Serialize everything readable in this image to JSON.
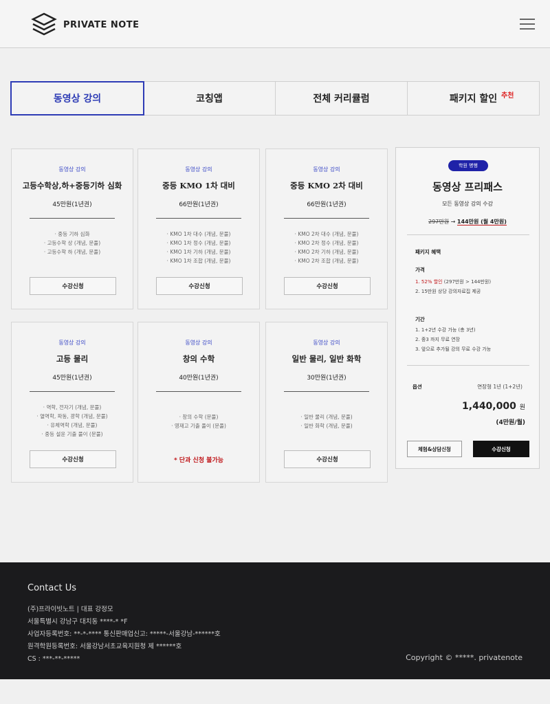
{
  "header": {
    "logo_text": "PRIVATE NOTE",
    "menu_icon": "hamburger-menu-icon"
  },
  "tabs": [
    {
      "label": "동영상 강의"
    },
    {
      "label": "코칭앱"
    },
    {
      "label": "전체 커리큘럼"
    },
    {
      "label": "패키지 할인",
      "badge": "추천"
    }
  ],
  "courses": [
    {
      "category": "동영상 강의",
      "title": "고등수학상,하+중등기하 심화",
      "price": "45만원(1년권)",
      "topics": [
        "· 중등 기하 심화",
        "· 고등수학 상 (개념, 문풀)",
        "· 고등수학 하 (개념, 문풀)"
      ],
      "cta": "수강신청"
    },
    {
      "category": "동영상 강의",
      "title": "중등 KMO 1차 대비",
      "price": "66만원(1년권)",
      "topics": [
        "· KMO 1차 대수 (개념, 문풀)",
        "· KMO 1차 정수 (개념, 문풀)",
        "· KMO 1차 기하 (개념, 문풀)",
        "· KMO 1차 조합 (개념, 문풀)"
      ],
      "cta": "수강신청"
    },
    {
      "category": "동영상 강의",
      "title": "중등 KMO 2차 대비",
      "price": "66만원(1년권)",
      "topics": [
        "· KMO 2차 대수 (개념, 문풀)",
        "· KMO 2차 정수 (개념, 문풀)",
        "· KMO 2차 기하 (개념, 문풀)",
        "· KMO 2차 조합 (개념, 문풀)"
      ],
      "cta": "수강신청"
    },
    {
      "category": "동영상 강의",
      "title": "고등 물리",
      "price": "45만원(1년권)",
      "topics": [
        "· 역학, 전자기 (개념, 문풀)",
        "· 열역학, 파동, 광학 (개념, 문풀)",
        "· 유체역학 (개념, 문풀)",
        "· 중등 설윤 기출 풀이 (문풀)"
      ],
      "cta": "수강신청"
    },
    {
      "category": "동영상 강의",
      "title": "창의 수학",
      "price": "40만원(1년권)",
      "topics": [
        "· 창의 수학 (문풀)",
        "· 영재고 기출 풀이 (문풀)"
      ],
      "warning": "* 단과 신청 불가능"
    },
    {
      "category": "동영상 강의",
      "title": "일반 물리, 일반 화학",
      "price": "30만원(1년권)",
      "topics": [
        "· 일반 물리 (개념, 문풀)",
        "· 일반 화학 (개념, 문풀)"
      ],
      "cta": "수강신청"
    }
  ],
  "panel": {
    "pill": "학원 병행",
    "title": "동영상 프리패스",
    "subtitle": "모든 동영상 강의 수강",
    "price_old": "297만원",
    "price_arrow": " → ",
    "price_new": "144만원 (월 4만원)",
    "benefit_heading": "패키지 혜택",
    "price_heading": "가격",
    "price_line1_prefix": "1. ",
    "price_line1_discount": "52% 할인",
    "price_line1_rest": " (297만원 > 144만원)",
    "price_line2": "2. 15만원 상당 강의자료집 제공",
    "period_heading": "기간",
    "period_lines": [
      "1. 1+2년 수강 가능 (총 3년)",
      "2. 중3 까지 무료 연장",
      "3. 앞으로 추가될 강의 무료 수강 가능"
    ],
    "option_label": "옵션",
    "option_value": "연장형 1년 (1+2년)",
    "total_amount": "1,440,000",
    "total_unit": "원",
    "monthly": "(4만원/월)",
    "consult_button": "체험&상담신청",
    "apply_button": "수강신청"
  },
  "footer": {
    "contact_heading": "Contact Us",
    "company": "(주)프라이빗노트 | 대표 강정모",
    "address": "서울특별시 강남구 대치동 ****-* *F",
    "business": "사업자등록번호: **-*-**** 통신판매업신고: *****-서울강남-******호",
    "academy": "원격학원등록번호: 서울강남서초교육지원청 제 ******호",
    "cs": "CS : ***-**-*****",
    "copyright": "Copyright © *****. privatenote"
  }
}
